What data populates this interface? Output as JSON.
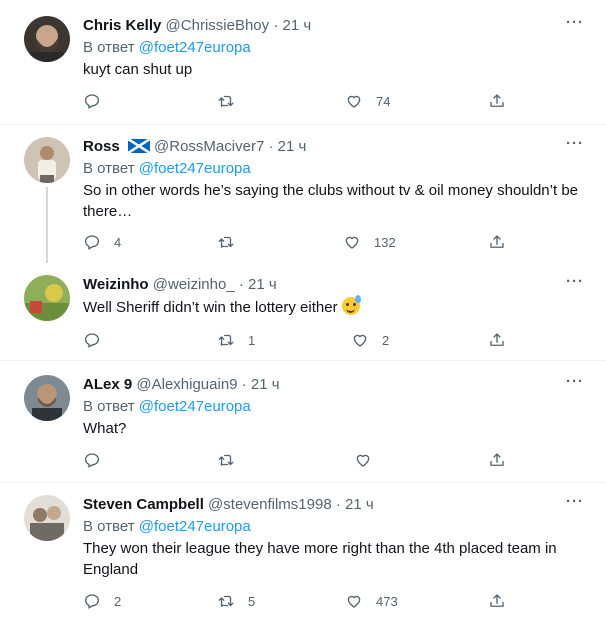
{
  "reply_prefix": "В ответ",
  "tweets": [
    {
      "name": "Chris Kelly",
      "handle": "@ChrissieBhoy",
      "time": "21 ч",
      "reply_to": "@foet247europa",
      "text": "kuyt can shut up",
      "reply_count": "",
      "retweet_count": "",
      "like_count": "74",
      "avatar_colors": [
        "#4a3b30",
        "#c9a58a"
      ]
    },
    {
      "name": "Ross",
      "handle": "@RossMaciver7",
      "time": "21 ч",
      "reply_to": "@foet247europa",
      "text": "So in other words he’s saying the clubs without tv & oil money shouldn’t be there…",
      "reply_count": "4",
      "retweet_count": "",
      "like_count": "132",
      "flag": "scotland-flag-icon",
      "avatar_colors": [
        "#b7a58e",
        "#e8dccb"
      ]
    },
    {
      "name": "Weizinho",
      "handle": "@weizinho_",
      "time": "21 ч",
      "text": "Well Sheriff didn’t win the lottery either",
      "emoji": "sweat-smile-emoji",
      "reply_count": "",
      "retweet_count": "1",
      "like_count": "2",
      "avatar_colors": [
        "#6d8f3c",
        "#d9c84a"
      ]
    },
    {
      "name": "ALex 9",
      "handle": "@Alexhiguain9",
      "time": "21 ч",
      "reply_to": "@foet247europa",
      "text": "What?",
      "reply_count": "",
      "retweet_count": "",
      "like_count": "",
      "avatar_colors": [
        "#6b5a4c",
        "#b89677"
      ]
    },
    {
      "name": "Steven Campbell",
      "handle": "@stevenfilms1998",
      "time": "21 ч",
      "reply_to": "@foet247europa",
      "text": "They won their league they have more right than the 4th placed team in England",
      "reply_count": "2",
      "retweet_count": "5",
      "like_count": "473",
      "avatar_colors": [
        "#8f8b86",
        "#e2ddd6"
      ]
    }
  ],
  "colors": {
    "link": "#1d9bf0",
    "secondary": "#536471",
    "divider": "#eff3f4",
    "thread_line": "#cfd9de"
  }
}
